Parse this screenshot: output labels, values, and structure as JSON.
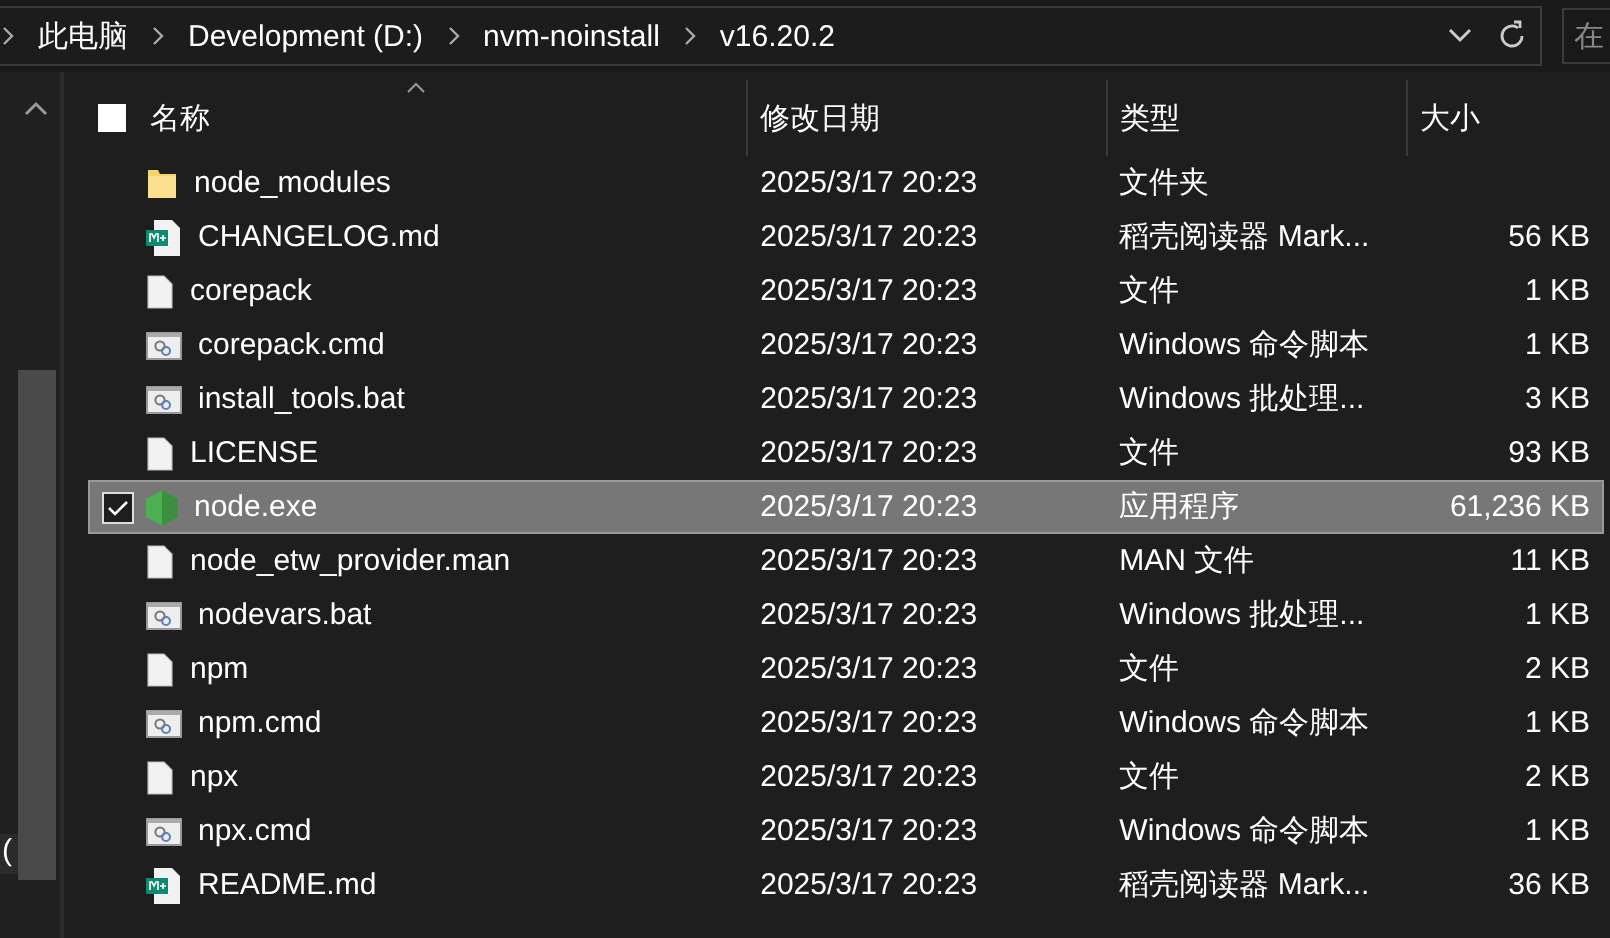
{
  "address_bar": {
    "segments": [
      "此电脑",
      "Development (D:)",
      "nvm-noinstall",
      "v16.20.2"
    ]
  },
  "search": {
    "placeholder": "在"
  },
  "nav_pane": {
    "text": "("
  },
  "select_all": {
    "checked": false
  },
  "columns": [
    {
      "label": "名称",
      "sorted": true
    },
    {
      "label": "修改日期",
      "sorted": false
    },
    {
      "label": "类型",
      "sorted": false
    },
    {
      "label": "大小",
      "sorted": false
    }
  ],
  "rows": [
    {
      "kind": "folder",
      "name": "node_modules",
      "modified": "2025/3/17 20:23",
      "type": "文件夹",
      "size": "",
      "selected": false
    },
    {
      "kind": "markdown",
      "name": "CHANGELOG.md",
      "modified": "2025/3/17 20:23",
      "type": "稻壳阅读器 Mark...",
      "size": "56 KB",
      "selected": false
    },
    {
      "kind": "file",
      "name": "corepack",
      "modified": "2025/3/17 20:23",
      "type": "文件",
      "size": "1 KB",
      "selected": false
    },
    {
      "kind": "script",
      "name": "corepack.cmd",
      "modified": "2025/3/17 20:23",
      "type": "Windows 命令脚本",
      "size": "1 KB",
      "selected": false
    },
    {
      "kind": "script",
      "name": "install_tools.bat",
      "modified": "2025/3/17 20:23",
      "type": "Windows 批处理...",
      "size": "3 KB",
      "selected": false
    },
    {
      "kind": "file",
      "name": "LICENSE",
      "modified": "2025/3/17 20:23",
      "type": "文件",
      "size": "93 KB",
      "selected": false
    },
    {
      "kind": "exe",
      "name": "node.exe",
      "modified": "2025/3/17 20:23",
      "type": "应用程序",
      "size": "61,236 KB",
      "selected": true
    },
    {
      "kind": "file",
      "name": "node_etw_provider.man",
      "modified": "2025/3/17 20:23",
      "type": "MAN 文件",
      "size": "11 KB",
      "selected": false
    },
    {
      "kind": "script",
      "name": "nodevars.bat",
      "modified": "2025/3/17 20:23",
      "type": "Windows 批处理...",
      "size": "1 KB",
      "selected": false
    },
    {
      "kind": "file",
      "name": "npm",
      "modified": "2025/3/17 20:23",
      "type": "文件",
      "size": "2 KB",
      "selected": false
    },
    {
      "kind": "script",
      "name": "npm.cmd",
      "modified": "2025/3/17 20:23",
      "type": "Windows 命令脚本",
      "size": "1 KB",
      "selected": false
    },
    {
      "kind": "file",
      "name": "npx",
      "modified": "2025/3/17 20:23",
      "type": "文件",
      "size": "2 KB",
      "selected": false
    },
    {
      "kind": "script",
      "name": "npx.cmd",
      "modified": "2025/3/17 20:23",
      "type": "Windows 命令脚本",
      "size": "1 KB",
      "selected": false
    },
    {
      "kind": "markdown",
      "name": "README.md",
      "modified": "2025/3/17 20:23",
      "type": "稻壳阅读器 Mark...",
      "size": "36 KB",
      "selected": false
    }
  ]
}
